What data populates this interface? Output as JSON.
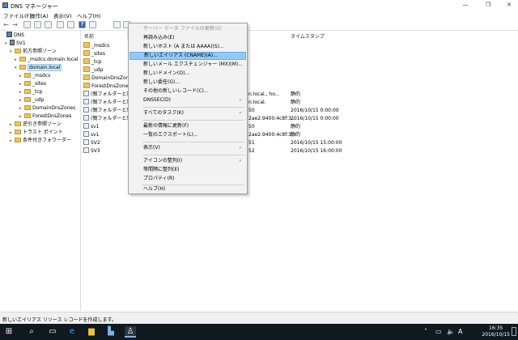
{
  "window": {
    "title": "DNS マネージャー"
  },
  "menubar": [
    "ファイル(F)",
    "操作(A)",
    "表示(V)",
    "ヘルプ(H)"
  ],
  "tree": [
    {
      "label": "DNS",
      "level": 0,
      "icon": "dns-icon",
      "expander": ""
    },
    {
      "label": "SV1",
      "level": 1,
      "icon": "server-icon",
      "expander": "▾"
    },
    {
      "label": "前方参照ゾーン",
      "level": 2,
      "icon": "folder-icon",
      "expander": "▾"
    },
    {
      "label": "_msdcs.domain.local",
      "level": 3,
      "icon": "folder-icon",
      "expander": "▸"
    },
    {
      "label": "domain.local",
      "level": 3,
      "icon": "folder-icon",
      "expander": "▾",
      "selected": true
    },
    {
      "label": "_msdcs",
      "level": 4,
      "icon": "folder-icon",
      "expander": "▸"
    },
    {
      "label": "_sites",
      "level": 4,
      "icon": "folder-icon",
      "expander": "▸"
    },
    {
      "label": "_tcp",
      "level": 4,
      "icon": "folder-icon",
      "expander": "▸"
    },
    {
      "label": "_udp",
      "level": 4,
      "icon": "folder-icon",
      "expander": "▸"
    },
    {
      "label": "DomainDnsZones",
      "level": 4,
      "icon": "folder-icon",
      "expander": "▸"
    },
    {
      "label": "ForestDnsZones",
      "level": 4,
      "icon": "folder-icon",
      "expander": "▸"
    },
    {
      "label": "逆引き参照ゾーン",
      "level": 2,
      "icon": "folder-icon",
      "expander": "▸"
    },
    {
      "label": "トラスト ポイント",
      "level": 2,
      "icon": "folder-icon",
      "expander": "▸"
    },
    {
      "label": "条件付きフォワーダー",
      "level": 2,
      "icon": "folder-icon",
      "expander": "▸"
    }
  ],
  "list": {
    "headers": {
      "name": "名前",
      "timestamp": "タイムスタンプ"
    },
    "rows": [
      {
        "name": "_msdcs",
        "icon": "folder-icon",
        "data": "",
        "timestamp": ""
      },
      {
        "name": "_sites",
        "icon": "folder-icon",
        "data": "",
        "timestamp": ""
      },
      {
        "name": "_tcp",
        "icon": "folder-icon",
        "data": "",
        "timestamp": ""
      },
      {
        "name": "_udp",
        "icon": "folder-icon",
        "data": "",
        "timestamp": ""
      },
      {
        "name": "DomainDnsZones",
        "icon": "folder-icon",
        "data": "",
        "timestamp": ""
      },
      {
        "name": "ForestDnsZones",
        "icon": "folder-icon",
        "data": "",
        "timestamp": ""
      },
      {
        "name": "(親フォルダーと同じ",
        "icon": "record-icon",
        "data": "n.local., ho...",
        "timestamp": "静的"
      },
      {
        "name": "(親フォルダーと同じ",
        "icon": "record-icon",
        "data": "n.local.",
        "timestamp": "静的"
      },
      {
        "name": "(親フォルダーと同じ",
        "icon": "record-icon",
        "data": "50",
        "timestamp": "2016/10/15 0:00:00"
      },
      {
        "name": "(親フォルダーと同じ",
        "icon": "record-icon",
        "data": "2ae2:9400:4c8f:3...",
        "timestamp": "2016/10/15 0:00:00"
      },
      {
        "name": "sv1",
        "icon": "record-icon",
        "data": "50",
        "timestamp": "静的"
      },
      {
        "name": "sv1",
        "icon": "record-icon",
        "data": "2ae2:9400:4c8f:3...",
        "timestamp": "静的"
      },
      {
        "name": "SV2",
        "icon": "record-icon",
        "data": "51",
        "timestamp": "2016/10/15 15:00:00"
      },
      {
        "name": "SV3",
        "icon": "record-icon",
        "data": "52",
        "timestamp": "2016/10/15 16:00:00"
      }
    ]
  },
  "context_menu": [
    {
      "label": "サーバー データ ファイルの更新(U)",
      "disabled": true
    },
    {
      "label": "再読み込み(E)"
    },
    {
      "label": "新しいホスト (A または AAAA)(S)..."
    },
    {
      "label": "新しいエイリアス (CNAME)(A)...",
      "highlighted": true
    },
    {
      "label": "新しいメール エクスチェンジャー (MX)(M)..."
    },
    {
      "label": "新しいドメイン(O)..."
    },
    {
      "label": "新しい委任(G)..."
    },
    {
      "label": "その他の新しいレコード(C)..."
    },
    {
      "label": "DNSSEC(D)",
      "submenu": true
    },
    {
      "separator": true
    },
    {
      "label": "すべてのタスク(K)",
      "submenu": true
    },
    {
      "separator": true
    },
    {
      "label": "最新の情報に更新(F)"
    },
    {
      "label": "一覧のエクスポート(L)..."
    },
    {
      "separator": true
    },
    {
      "label": "表示(V)",
      "submenu": true
    },
    {
      "separator": true
    },
    {
      "label": "アイコンの整列(I)",
      "submenu": true
    },
    {
      "label": "等間隔に整列(E)"
    },
    {
      "label": "プロパティ(R)"
    },
    {
      "separator": true
    },
    {
      "label": "ヘルプ(H)"
    }
  ],
  "statusbar": {
    "text": "新しいエイリアス リソース レコードを作成します。"
  },
  "taskbar": {
    "time": "16:35",
    "date": "2016/10/15",
    "ime": "A"
  }
}
